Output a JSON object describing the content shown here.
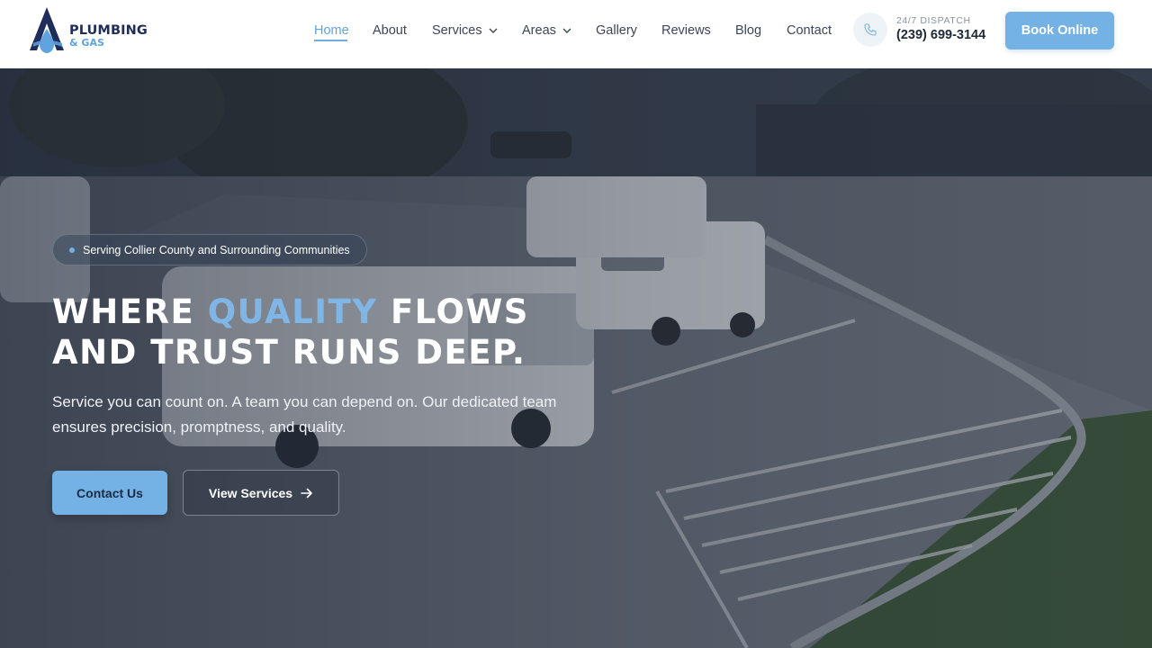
{
  "brand": {
    "name_line1": "PLUMBING",
    "name_line2": "& GAS",
    "primary_color": "#1e2d59",
    "accent_color": "#5fa3df"
  },
  "nav": {
    "items": [
      {
        "label": "Home",
        "active": true
      },
      {
        "label": "About"
      },
      {
        "label": "Services",
        "dropdown": true
      },
      {
        "label": "Areas",
        "dropdown": true
      },
      {
        "label": "Gallery"
      },
      {
        "label": "Reviews"
      },
      {
        "label": "Blog"
      },
      {
        "label": "Contact"
      }
    ]
  },
  "dispatch": {
    "label": "24/7 DISPATCH",
    "phone": "(239) 699-3144",
    "icon": "phone-icon"
  },
  "header_cta": {
    "label": "Book Online"
  },
  "hero": {
    "badge": "Serving Collier County and Surrounding Communities",
    "headline_part1": "WHERE ",
    "headline_accent": "QUALITY",
    "headline_part2": " FLOWS",
    "headline_line2": "AND TRUST RUNS DEEP.",
    "subtext": "Service you can count on. A team you can depend on. Our dedicated team ensures precision, promptness, and quality.",
    "primary_cta": "Contact Us",
    "secondary_cta": "View Services",
    "secondary_icon": "arrow-right-icon",
    "background": "video-still-service-vans-parking-lot"
  }
}
